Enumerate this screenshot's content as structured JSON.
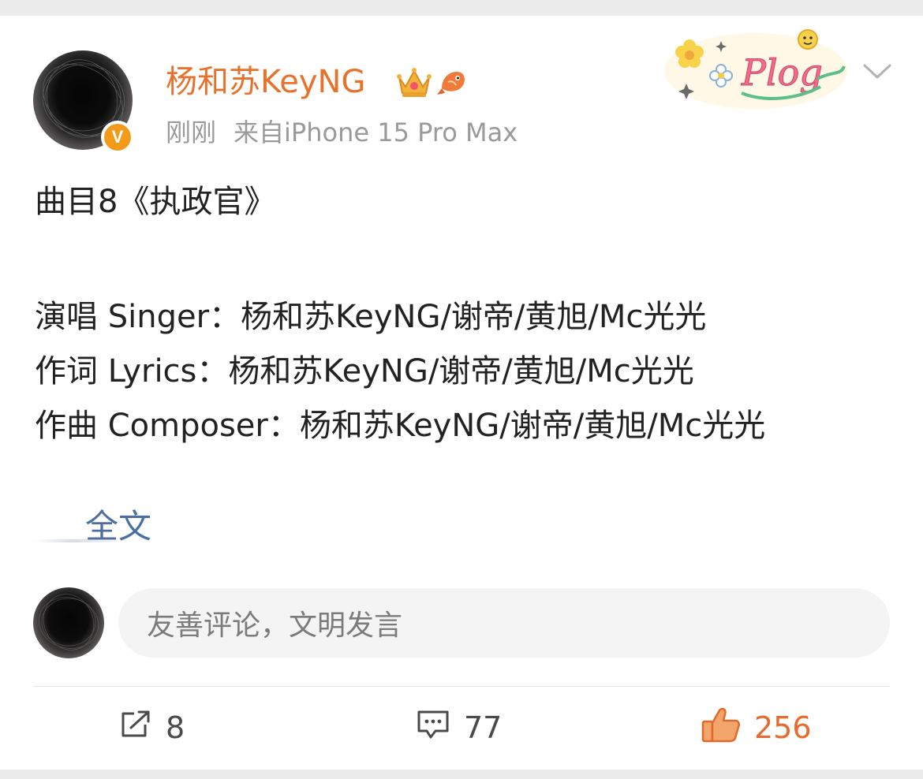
{
  "post": {
    "username": "杨和苏KeyNG",
    "time": "刚刚",
    "source": "来自iPhone 15 Pro Max",
    "title": "曲目8《执政官》",
    "credits": [
      "演唱 Singer：杨和苏KeyNG/谢帝/黄旭/Mc光光",
      "作词 Lyrics：杨和苏KeyNG/谢帝/黄旭/Mc光光",
      "作曲 Composer：杨和苏KeyNG/谢帝/黄旭/Mc光光"
    ],
    "full_text_label": "全文",
    "verified_badge": "V",
    "sticker_text": "Plog"
  },
  "comment": {
    "placeholder": "友善评论，文明发言"
  },
  "actions": {
    "share_count": "8",
    "comment_count": "77",
    "like_count": "256"
  },
  "colors": {
    "username": "#e8712c",
    "link": "#4a6fa0",
    "like": "#e86a2c",
    "verified": "#f39a1b"
  }
}
